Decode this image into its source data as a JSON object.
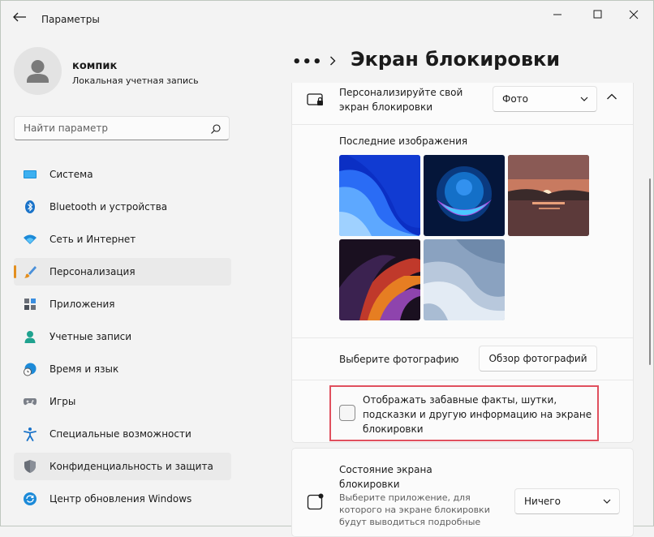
{
  "window": {
    "title": "Параметры",
    "controls": [
      "minimize",
      "maximize",
      "close"
    ]
  },
  "profile": {
    "name": "компик",
    "account_type": "Локальная учетная запись"
  },
  "search": {
    "placeholder": "Найти параметр",
    "value": ""
  },
  "sidebar": {
    "items": [
      {
        "label": "Система",
        "icon": "monitor-icon",
        "selected": false
      },
      {
        "label": "Bluetooth и устройства",
        "icon": "bluetooth-icon",
        "selected": false
      },
      {
        "label": "Сеть и Интернет",
        "icon": "wifi-icon",
        "selected": false
      },
      {
        "label": "Персонализация",
        "icon": "brush-icon",
        "selected": true
      },
      {
        "label": "Приложения",
        "icon": "apps-icon",
        "selected": false
      },
      {
        "label": "Учетные записи",
        "icon": "person-icon",
        "selected": false
      },
      {
        "label": "Время и язык",
        "icon": "globe-clock-icon",
        "selected": false
      },
      {
        "label": "Игры",
        "icon": "gamepad-icon",
        "selected": false
      },
      {
        "label": "Специальные возможности",
        "icon": "accessibility-icon",
        "selected": false
      },
      {
        "label": "Конфиденциальность и защита",
        "icon": "shield-icon",
        "selected": false
      },
      {
        "label": "Центр обновления Windows",
        "icon": "update-icon",
        "selected": false
      }
    ]
  },
  "header": {
    "breadcrumb_overflow": "•••",
    "title": "Экран блокировки"
  },
  "personalize": {
    "label": "Персонализируйте свой экран блокировки",
    "selected_option": "Фото",
    "recent_images_label": "Последние изображения",
    "recent_images": [
      "bloom-blue-icon",
      "glow-orb-icon",
      "sunset-lake-icon",
      "ribbon-dark-icon",
      "waves-gray-icon"
    ],
    "choose_photo_label": "Выберите фотографию",
    "browse_button": "Обзор фотографий",
    "fun_facts_label": "Отображать забавные факты, шутки, подсказки и другую информацию на экране блокировки",
    "fun_facts_checked": false
  },
  "lock_status": {
    "title": "Состояние экрана блокировки",
    "description": "Выберите приложение, для которого на экране блокировки будут выводиться подробные",
    "selected_option": "Ничего"
  },
  "colors": {
    "accent": "#e38f1f",
    "highlight_box": "#e0505e",
    "selected_nav_bg": "#eaeaea"
  }
}
